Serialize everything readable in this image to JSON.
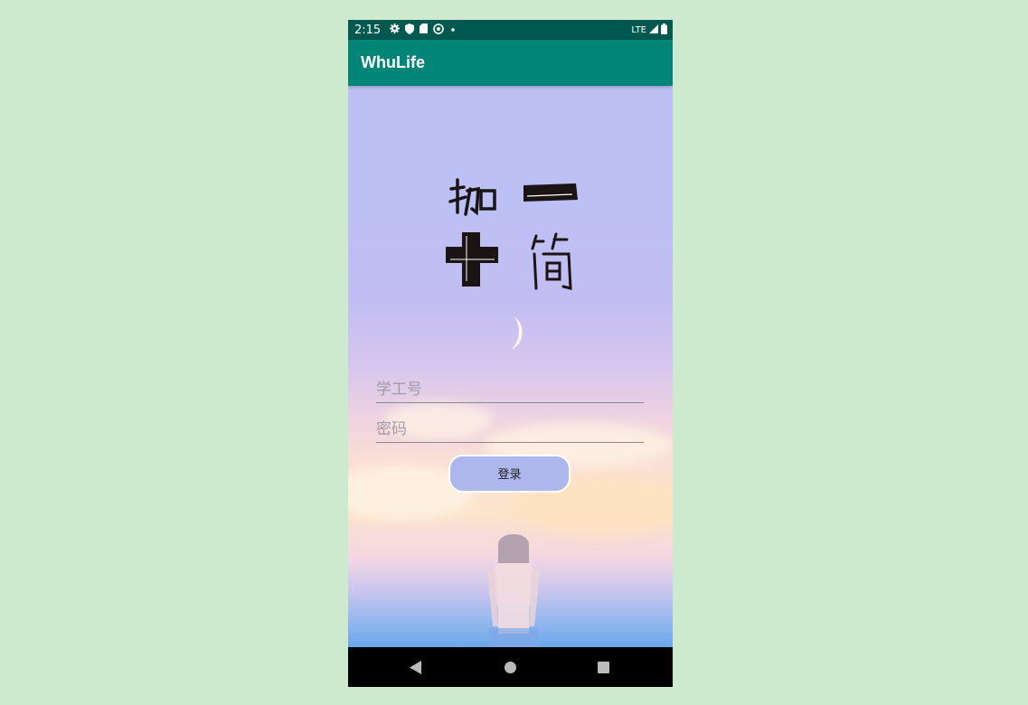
{
  "status_bar": {
    "time": "2:15",
    "network": "LTE",
    "icons": [
      "gear-icon",
      "shield-icon",
      "sd-card-icon",
      "sync-icon",
      "dot-icon",
      "signal-icon",
      "battery-icon"
    ]
  },
  "app_bar": {
    "title": "WhuLife"
  },
  "login": {
    "student_id_placeholder": "学工号",
    "password_placeholder": "密码",
    "login_button": "登录"
  },
  "nav_bar": {
    "icons": [
      "back-icon",
      "home-icon",
      "recents-icon"
    ]
  },
  "colors": {
    "status_bar": "#00584e",
    "app_bar": "#018577",
    "button": "#adb7ec",
    "page_background": "#cde9cf"
  }
}
